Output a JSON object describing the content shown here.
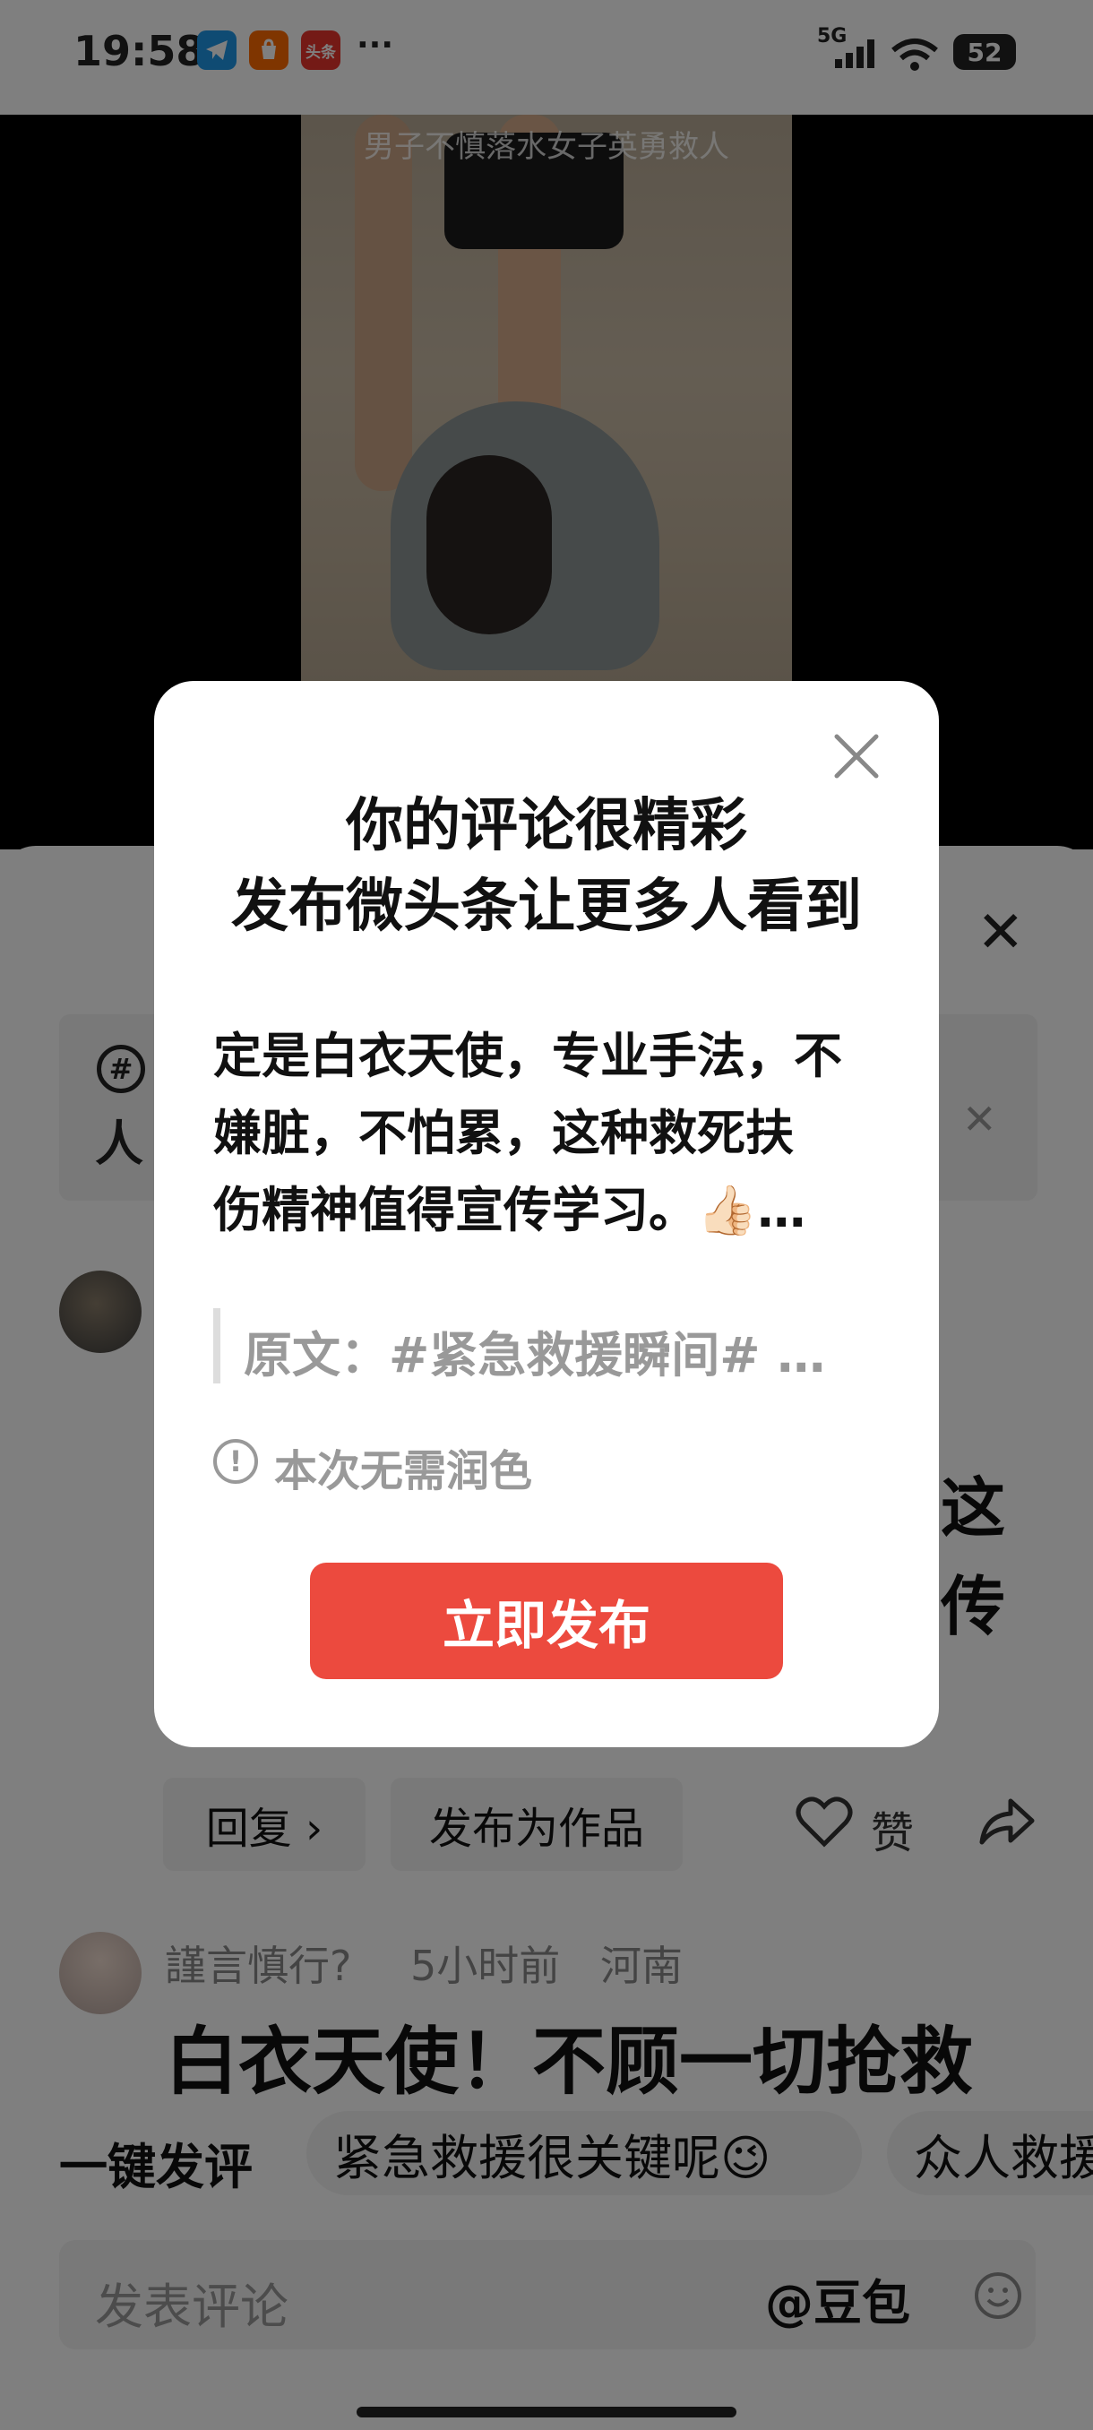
{
  "status_bar": {
    "time": "19:58",
    "app_badges": [
      {
        "icon": "telegram-icon",
        "label": "",
        "color": "#1e96e6"
      },
      {
        "icon": "taobao-icon",
        "label": "",
        "color": "#ff6a00"
      },
      {
        "icon": "toutiao-icon",
        "label": "头条",
        "color": "#e8342c"
      }
    ],
    "more": "···",
    "network": "5G",
    "battery": "52"
  },
  "video": {
    "caption": "男子不慎落水女子英勇救人"
  },
  "sheet": {
    "close_icon": "close-icon",
    "topic": {
      "hash_icon": "hashtag-icon",
      "text": "人",
      "close_icon": "close-icon"
    },
    "comment1": {
      "partial_line1": "这",
      "partial_line2": "传"
    },
    "actions": {
      "reply": "回复 ›",
      "publish_as_work": "发布为作品",
      "like": "赞"
    },
    "comment2": {
      "username": "謹言慎行?",
      "time": "5小时前",
      "location": "河南",
      "text": "白衣天使！不顾一切抢救"
    },
    "quick_comment": {
      "label": "一键发评",
      "chips": [
        "紧急救援很关键呢😉",
        "众人救援"
      ]
    },
    "input": {
      "placeholder": "发表评论",
      "mention": "@豆包",
      "emoji_icon": "emoji-icon"
    }
  },
  "dialog": {
    "title_line1": "你的评论很精彩",
    "title_line2": "发布微头条让更多人看到",
    "body_line1": "定是白衣天使，专业手法，不",
    "body_line2": "嫌脏，不怕累，这种救死扶",
    "body_line3": "伤精神值得宣传学习。👍🏻…",
    "quote": "原文：#紧急救援瞬间# …",
    "note_icon": "!",
    "note": "本次无需润色",
    "publish_button": "立即发布",
    "accent_color": "#ec4a3e"
  }
}
